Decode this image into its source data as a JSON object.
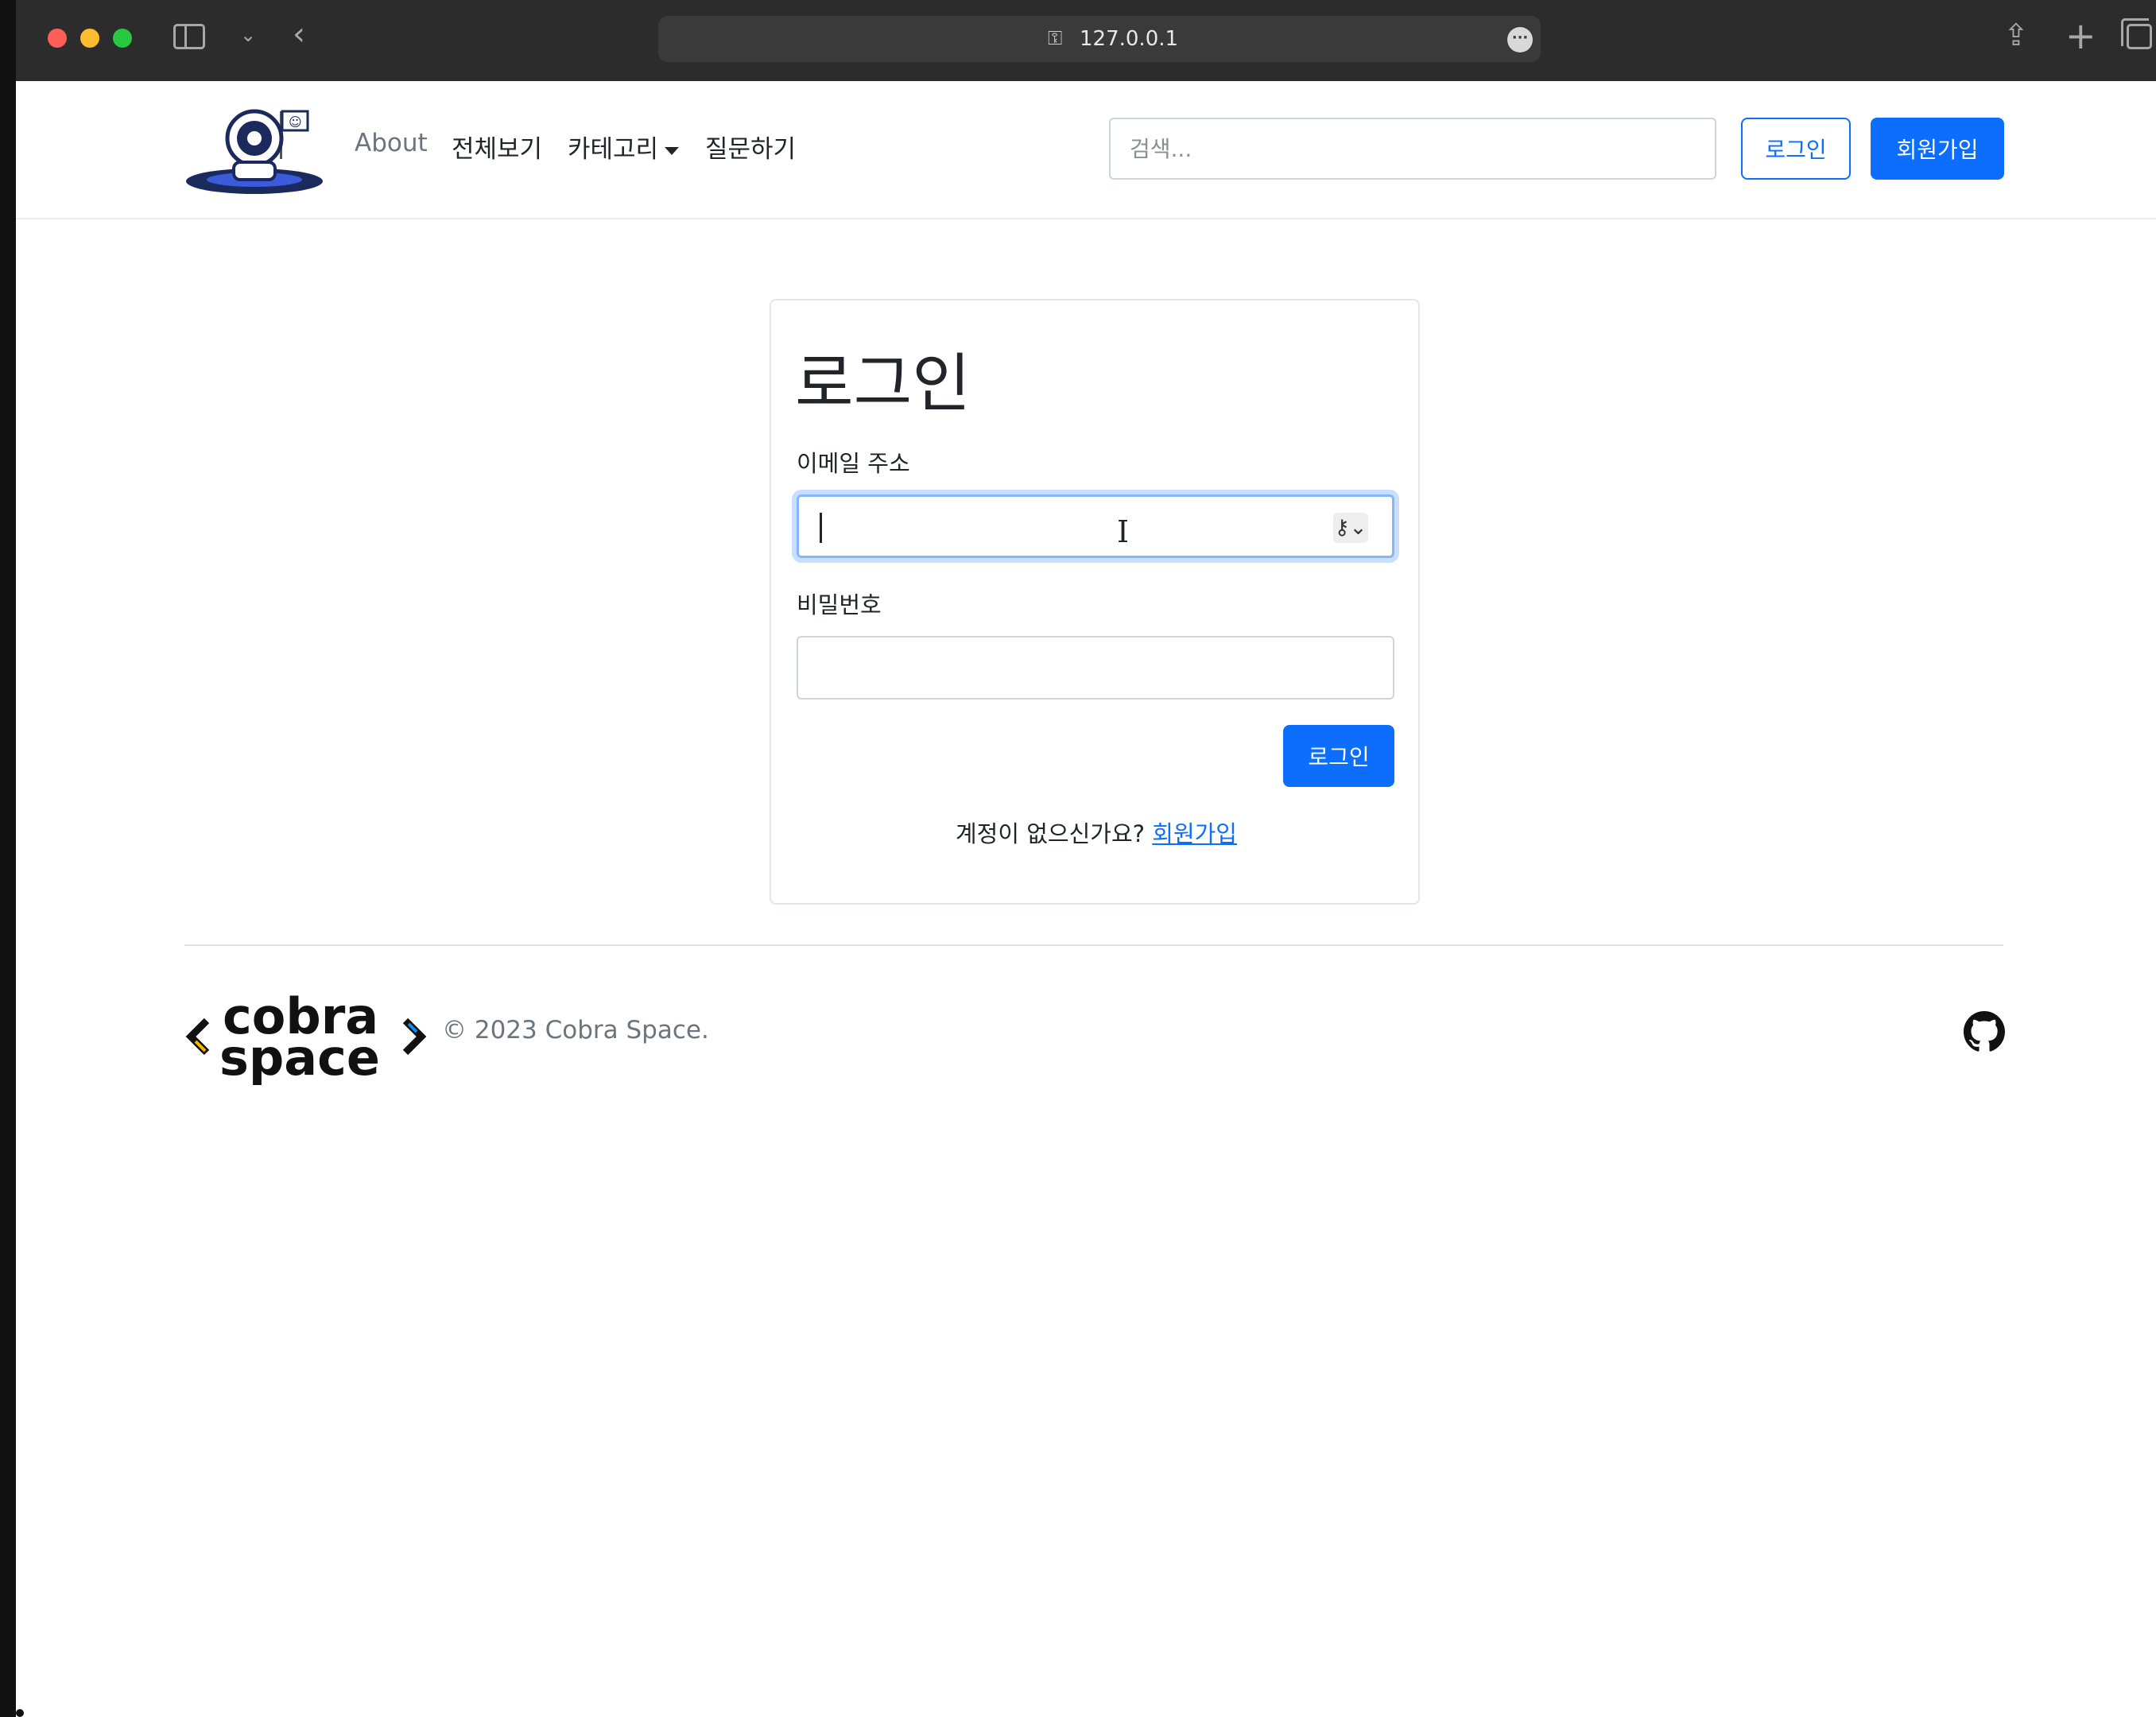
{
  "browser": {
    "url": "127.0.0.1"
  },
  "navbar": {
    "links": [
      "About",
      "전체보기",
      "카테고리",
      "질문하기"
    ],
    "search_placeholder": "검색...",
    "login_label": "로그인",
    "signup_label": "회원가입"
  },
  "login_card": {
    "title": "로그인",
    "email_label": "이메일 주소",
    "email_value": "",
    "password_label": "비밀번호",
    "password_value": "",
    "submit_label": "로그인",
    "no_account_text": "계정이 없으신가요?",
    "signup_link": "회원가입"
  },
  "footer": {
    "logo_text": [
      "cobra",
      "space"
    ],
    "copyright": "© 2023 Cobra Space."
  },
  "colors": {
    "primary": "#0d6efd",
    "muted": "#6c757d",
    "focus_ring": "#86b7fe"
  },
  "icons": [
    "sidebar-toggle-icon",
    "chevron-down-icon",
    "back-arrow-icon",
    "lock-icon",
    "more-icon",
    "share-icon",
    "new-tab-icon",
    "tabs-overview-icon",
    "key-icon",
    "github-icon"
  ]
}
